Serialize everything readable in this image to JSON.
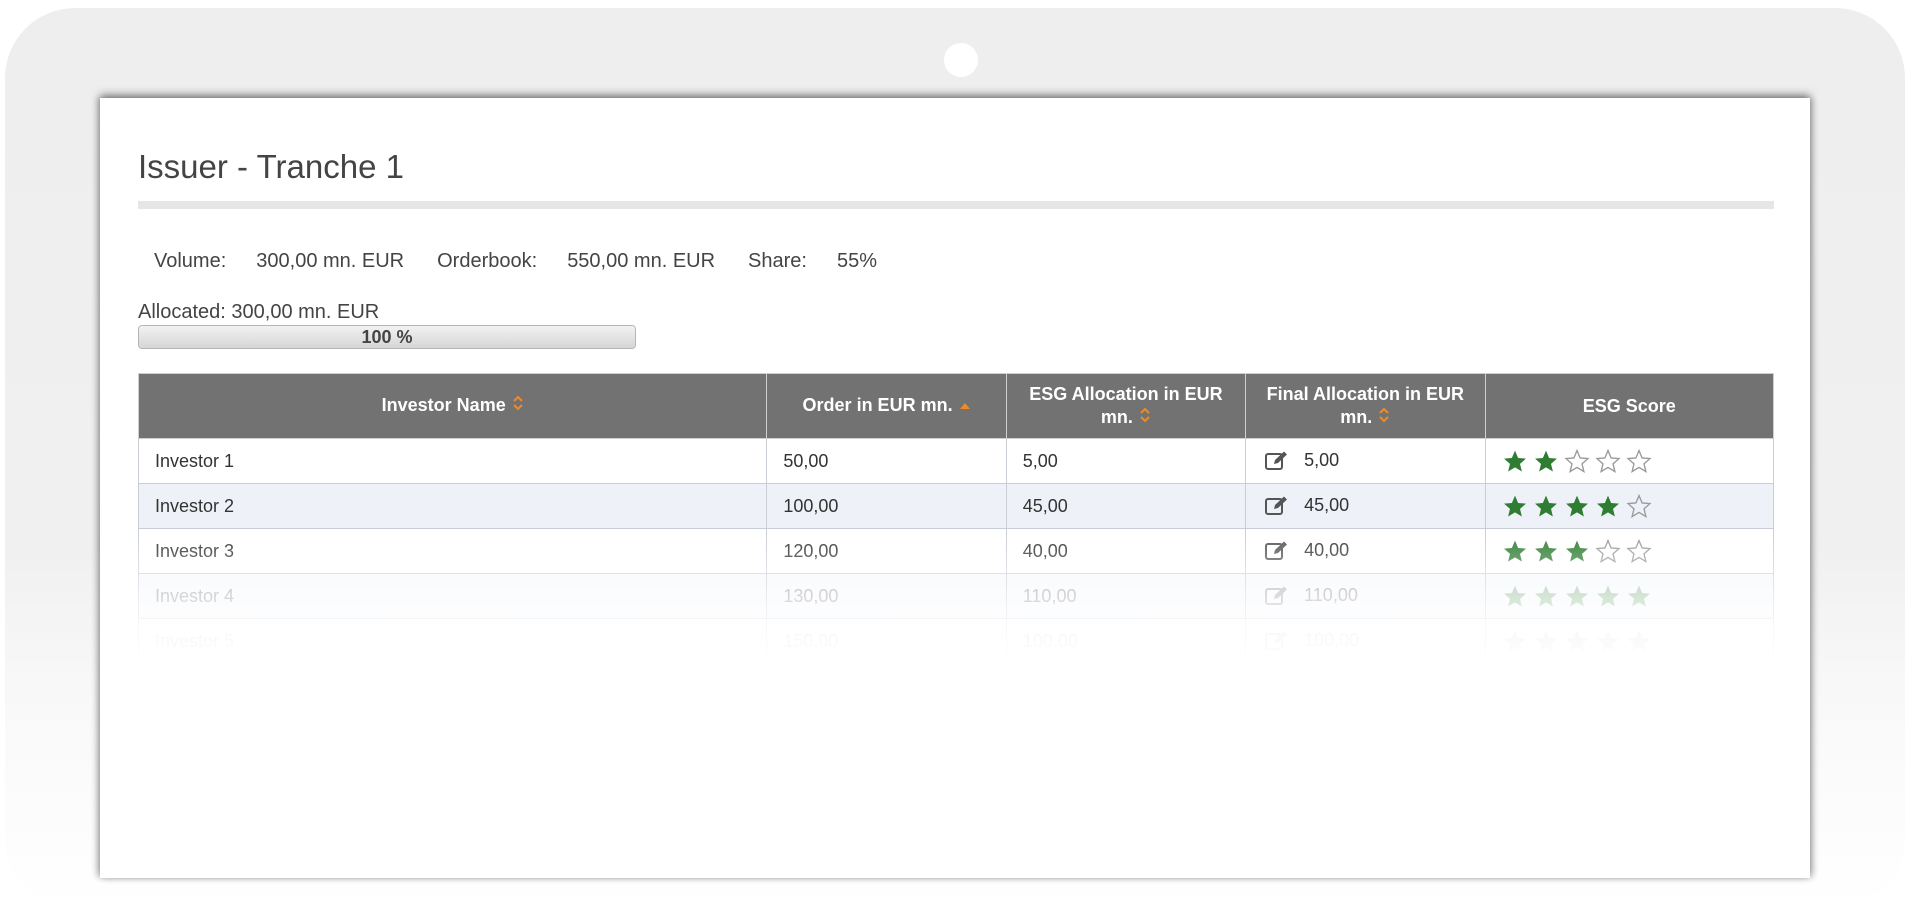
{
  "page": {
    "title": "Issuer - Tranche 1"
  },
  "summary": {
    "volume_label": "Volume:",
    "volume_value": "300,00 mn. EUR",
    "orderbook_label": "Orderbook:",
    "orderbook_value": "550,00 mn. EUR",
    "share_label": "Share:",
    "share_value": "55%"
  },
  "allocation": {
    "label": "Allocated: 300,00 mn. EUR",
    "progress_text": "100 %",
    "progress_fraction": 1.0
  },
  "table": {
    "columns": [
      {
        "label": "Investor Name",
        "sort": "unsorted"
      },
      {
        "label": "Order in EUR mn.",
        "sort": "ascending"
      },
      {
        "label": "ESG Allocation in EUR mn.",
        "sort": "unsorted"
      },
      {
        "label": "Final Allocation in EUR mn.",
        "sort": "unsorted"
      },
      {
        "label": "ESG Score",
        "sort": "none"
      }
    ],
    "rows": [
      {
        "name": "Investor 1",
        "order": "50,00",
        "esg_allocation": "5,00",
        "final_allocation": "5,00",
        "esg_score": 2,
        "max_score": 5
      },
      {
        "name": "Investor 2",
        "order": "100,00",
        "esg_allocation": "45,00",
        "final_allocation": "45,00",
        "esg_score": 4,
        "max_score": 5
      },
      {
        "name": "Investor 3",
        "order": "120,00",
        "esg_allocation": "40,00",
        "final_allocation": "40,00",
        "esg_score": 3,
        "max_score": 5
      },
      {
        "name": "Investor 4",
        "order": "130,00",
        "esg_allocation": "110,00",
        "final_allocation": "110,00",
        "esg_score": 5,
        "max_score": 5
      },
      {
        "name": "Investor 5",
        "order": "150,00",
        "esg_allocation": "100,00",
        "final_allocation": "100,00",
        "esg_score": 5,
        "max_score": 5
      }
    ]
  },
  "colors": {
    "header_bg": "#727272",
    "sort_accent": "#f08a24",
    "star_filled": "#2e7d32",
    "row_alt": "#eef2f8"
  },
  "icons": {
    "sort_unsorted": "sort-updown-icon",
    "sort_ascending": "sort-asc-icon",
    "edit": "edit-icon",
    "star_filled": "star-filled-icon",
    "star_empty": "star-outline-icon"
  }
}
